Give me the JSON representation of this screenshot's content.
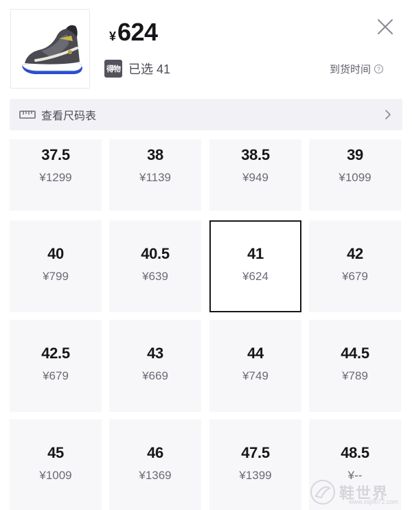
{
  "header": {
    "product_image": "sneaker-thumbnail",
    "currency_symbol": "¥",
    "price": "624",
    "brand_badge": "得物",
    "selected_text": "已选 41",
    "arrival_label": "到货时间",
    "close_icon": "close-icon",
    "help_icon": "question-circle-icon"
  },
  "size_chart": {
    "label": "查看尺码表",
    "icon": "ruler-icon",
    "chevron": "chevron-right-icon"
  },
  "sizes": [
    {
      "size": "37.5",
      "price": "¥1299"
    },
    {
      "size": "38",
      "price": "¥1139"
    },
    {
      "size": "38.5",
      "price": "¥949"
    },
    {
      "size": "39",
      "price": "¥1099"
    },
    {
      "size": "40",
      "price": "¥799"
    },
    {
      "size": "40.5",
      "price": "¥639"
    },
    {
      "size": "41",
      "price": "¥624",
      "selected": true
    },
    {
      "size": "42",
      "price": "¥679"
    },
    {
      "size": "42.5",
      "price": "¥679"
    },
    {
      "size": "43",
      "price": "¥669"
    },
    {
      "size": "44",
      "price": "¥749"
    },
    {
      "size": "44.5",
      "price": "¥789"
    },
    {
      "size": "45",
      "price": "¥1009"
    },
    {
      "size": "46",
      "price": "¥1369"
    },
    {
      "size": "47.5",
      "price": "¥1399"
    },
    {
      "size": "48.5",
      "price": "¥--"
    }
  ],
  "watermark": {
    "text": "鞋世界",
    "url": "www.xsj0072.com"
  },
  "colors": {
    "cell_bg": "#f7f7fa",
    "selected_border": "#16161a",
    "text_primary": "#16161a",
    "text_secondary": "#6a6a74"
  }
}
